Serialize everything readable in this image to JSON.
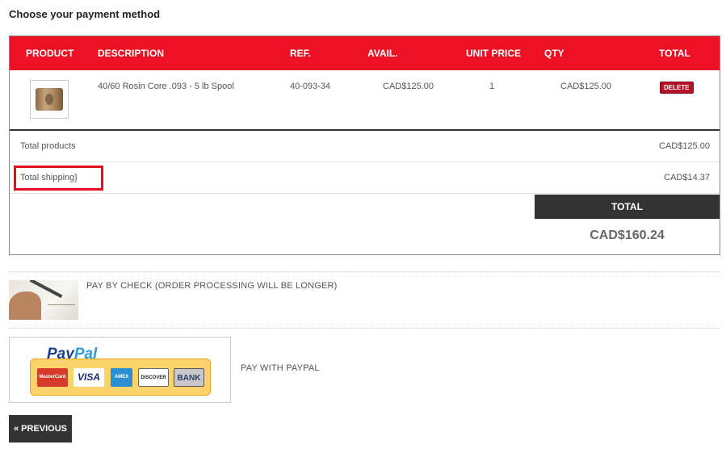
{
  "page": {
    "title": "Choose your payment method"
  },
  "cart": {
    "headers": [
      "PRODUCT",
      "DESCRIPTION",
      "REF.",
      "AVAIL.",
      "UNIT PRICE",
      "QTY",
      "TOTAL"
    ],
    "items": [
      {
        "description": "40/60 Rosin Core .093 - 5 lb Spool",
        "ref": "40-093-34",
        "unit_price": "CAD$125.00",
        "qty": "1",
        "total": "CAD$125.00",
        "delete_label": "DELETE"
      }
    ],
    "summary": {
      "total_products_label": "Total products",
      "total_products_value": "CAD$125.00",
      "total_shipping_label": "Total shipping}",
      "total_shipping_value": "CAD$14.37",
      "total_label": "TOTAL",
      "total_value": "CAD$160.24"
    }
  },
  "payment": {
    "check_label": "PAY BY CHECK (ORDER PROCESSING WILL BE LONGER)",
    "paypal_label": "PAY WITH PAYPAL",
    "paypal_logo": {
      "pay": "Pay",
      "pal": "Pal"
    },
    "cards": [
      "MasterCard",
      "VISA",
      "AMEX",
      "DISCOVER",
      "BANK"
    ]
  },
  "nav": {
    "previous_label": "« PREVIOUS"
  },
  "colors": {
    "accent": "#ed1123",
    "dark": "#333333",
    "highlight": "#e3101f"
  }
}
